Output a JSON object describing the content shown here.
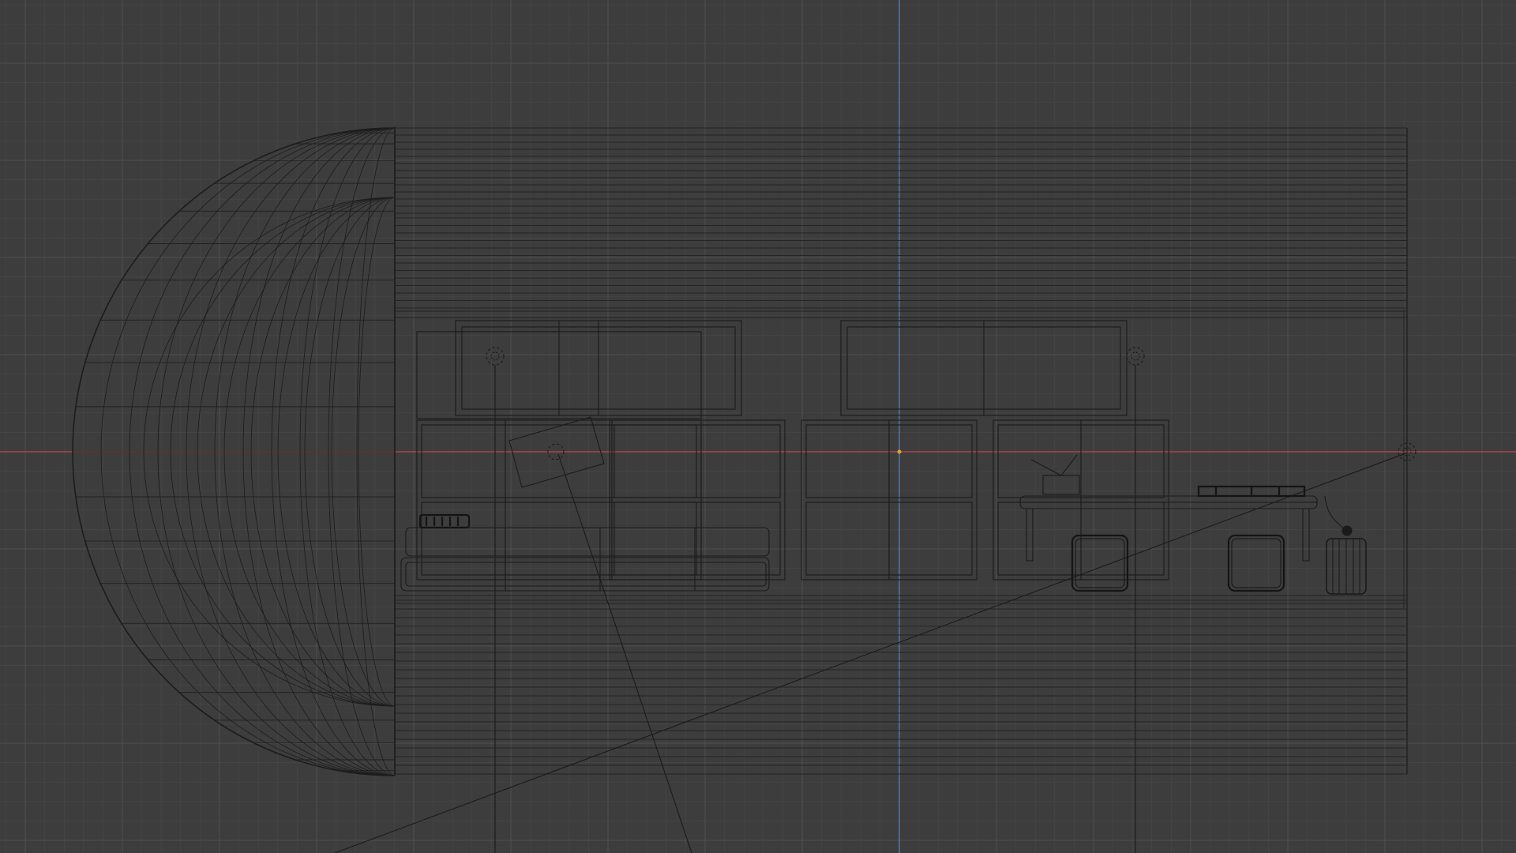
{
  "viewport": {
    "background_color": "#3d3d3d",
    "grid_minor_color": "#464646",
    "grid_major_color": "#505050",
    "axis_x_color": "#a8454f",
    "axis_y_color": "#4f7aa8",
    "wire_color": "#1a1a1a",
    "origin_color": "#e8a030"
  },
  "objects": [
    {
      "name": "dome-backdrop",
      "icon": "dome-wireframe-icon"
    },
    {
      "name": "back-wall-planes",
      "icon": "plane-wireframe-icon"
    },
    {
      "name": "shelf-unit-left",
      "icon": "shelf-icon"
    },
    {
      "name": "shelf-unit-center",
      "icon": "shelf-icon"
    },
    {
      "name": "shelf-unit-right",
      "icon": "shelf-icon"
    },
    {
      "name": "wall-frame-left",
      "icon": "frame-icon"
    },
    {
      "name": "wall-frame-right",
      "icon": "frame-icon"
    },
    {
      "name": "sofa",
      "icon": "sofa-icon"
    },
    {
      "name": "desk",
      "icon": "desk-icon"
    },
    {
      "name": "stool-left",
      "icon": "stool-icon"
    },
    {
      "name": "stool-right",
      "icon": "stool-icon"
    },
    {
      "name": "lamp",
      "icon": "lamp-icon"
    },
    {
      "name": "spot-light-left",
      "icon": "light-icon"
    },
    {
      "name": "spot-light-right",
      "icon": "light-icon"
    },
    {
      "name": "area-light",
      "icon": "light-icon"
    },
    {
      "name": "sun-light",
      "icon": "light-icon"
    }
  ]
}
